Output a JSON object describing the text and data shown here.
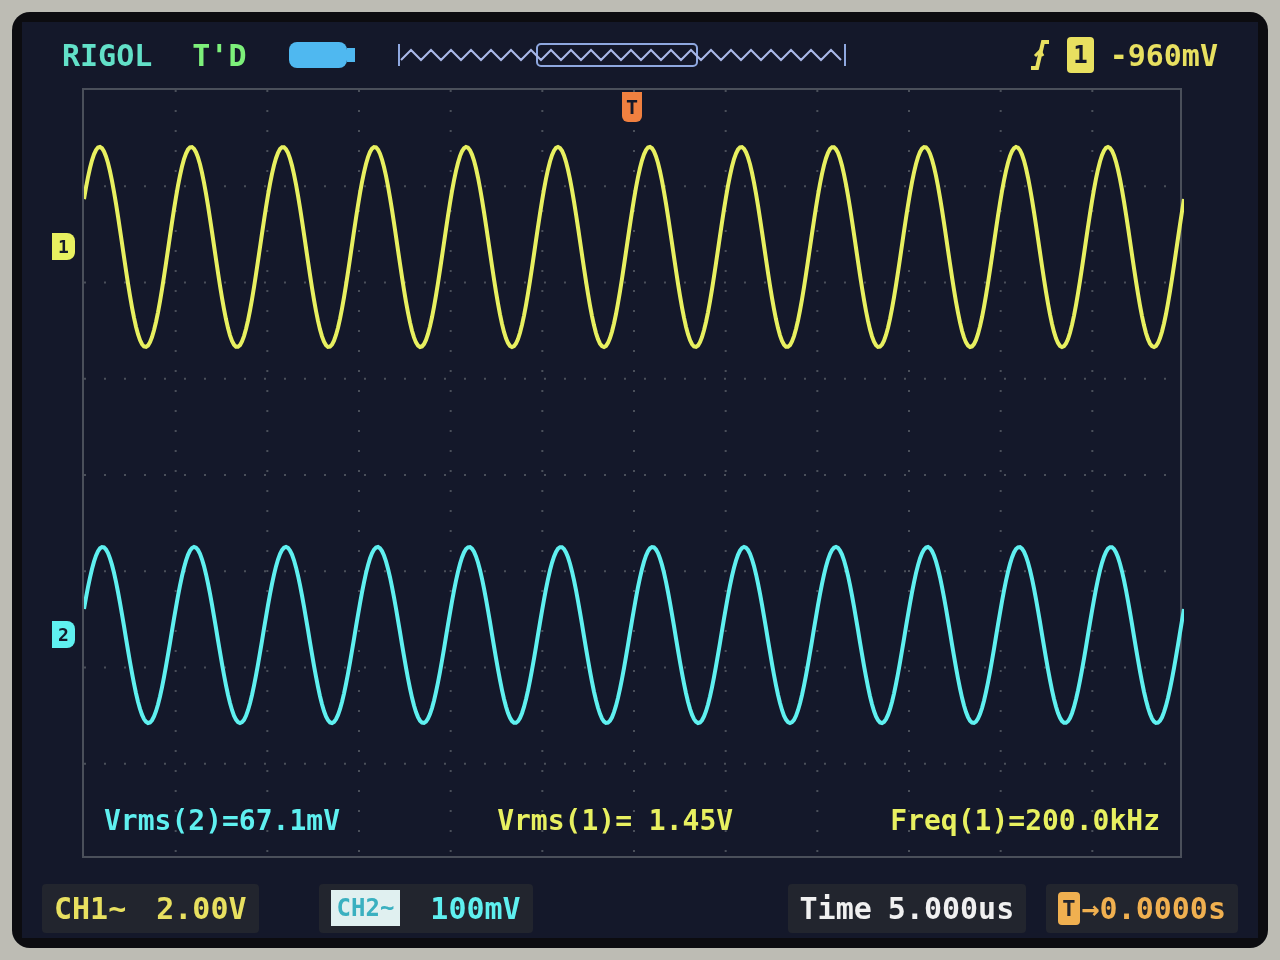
{
  "header": {
    "brand": "RIGOL",
    "status": "T'D",
    "trigger_source": "1",
    "trigger_level": "-960mV"
  },
  "trigger_marker": "T",
  "channels": [
    {
      "marker": "1",
      "color": "#e8f060"
    },
    {
      "marker": "2",
      "color": "#5ff0f0"
    }
  ],
  "measurements": [
    {
      "text": "Vrms(2)=67.1mV",
      "color": "#5ff0f0"
    },
    {
      "text": "Vrms(1)= 1.45V",
      "color": "#e8f060"
    },
    {
      "text": "Freq(1)=200.0kHz",
      "color": "#e8f060"
    }
  ],
  "status_bar": {
    "ch1": {
      "label": "CH1~",
      "scale": "2.00V"
    },
    "ch2": {
      "label": "CH2~",
      "scale": "100mV"
    },
    "time": {
      "label": "Time",
      "value": "5.000us"
    },
    "offset": {
      "badge": "T",
      "value": "→0.0000s"
    }
  }
}
